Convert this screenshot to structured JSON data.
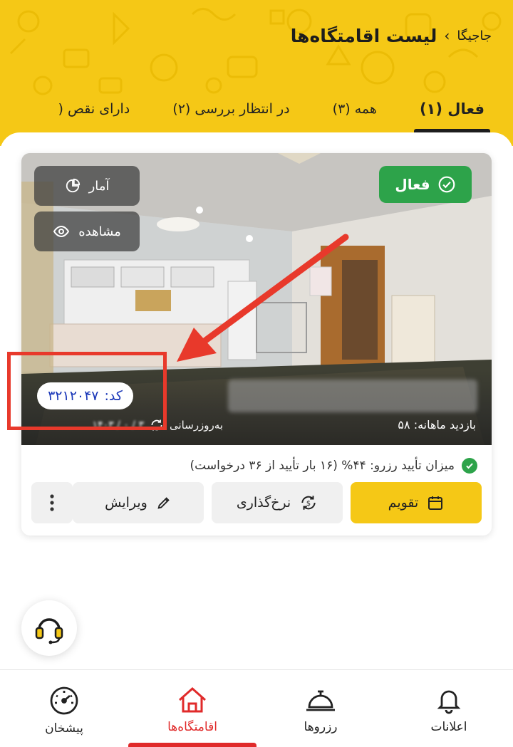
{
  "header": {
    "breadcrumb_root": "جاجیگا",
    "breadcrumb_chevron": "›",
    "title": "لیست اقامتگاه‌ها",
    "background_color": "#f5c816"
  },
  "tabs": [
    {
      "label": "فعال (۱)",
      "active": true
    },
    {
      "label": "همه (۳)",
      "active": false
    },
    {
      "label": "در انتظار بررسی (۲)",
      "active": false
    },
    {
      "label": "دارای نقص (",
      "active": false
    }
  ],
  "listing": {
    "status_label": "فعال",
    "status_color": "#2da34a",
    "stats_label": "آمار",
    "view_label": "مشاهده",
    "code_label": "کد:",
    "code_value": "۳۲۱۲۰۴۷",
    "monthly_visits": "بازدید ماهانه: ۵۸",
    "last_update_label": "به‌روزرسانی",
    "last_update_value": "۳ / ۰ / ۱۴۰۳",
    "approval_text": "میزان تأیید رزرو: ۴۴% (۱۶ بار تأیید از ۳۶ درخواست)"
  },
  "actions": {
    "calendar_label": "تقویم",
    "pricing_label": "نرخ‌گذاری",
    "edit_label": "ویرایش",
    "more_icon": "more-vertical-icon",
    "calendar_color": "#f5c816"
  },
  "support": {
    "icon": "headset-icon"
  },
  "bottom_nav": [
    {
      "label": "اعلانات",
      "icon": "bell-icon",
      "active": false
    },
    {
      "label": "رزروها",
      "icon": "service-bell-icon",
      "active": false
    },
    {
      "label": "اقامتگاه‌ها",
      "icon": "house-icon",
      "active": true
    },
    {
      "label": "پیشخان",
      "icon": "dashboard-gauge-icon",
      "active": false
    }
  ],
  "accent_color": "#e02a2a",
  "annotation_color": "#e8392b"
}
